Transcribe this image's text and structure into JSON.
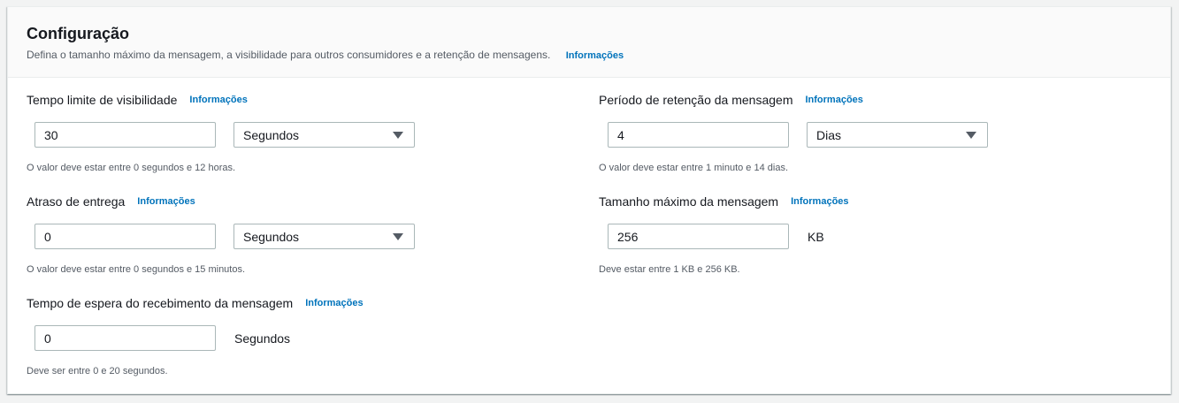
{
  "section": {
    "title": "Configuração",
    "description": "Defina o tamanho máximo da mensagem, a visibilidade para outros consumidores e a retenção de mensagens.",
    "info_link": "Informações"
  },
  "fields": {
    "visibility_timeout": {
      "label": "Tempo limite de visibilidade",
      "info_link": "Informações",
      "value": "30",
      "unit": "Segundos",
      "hint": "O valor deve estar entre 0 segundos e 12 horas."
    },
    "delivery_delay": {
      "label": "Atraso de entrega",
      "info_link": "Informações",
      "value": "0",
      "unit": "Segundos",
      "hint": "O valor deve estar entre 0 segundos e 15 minutos."
    },
    "receive_wait_time": {
      "label": "Tempo de espera do recebimento da mensagem",
      "info_link": "Informações",
      "value": "0",
      "unit": "Segundos",
      "hint": "Deve ser entre 0 e 20 segundos."
    },
    "retention_period": {
      "label": "Período de retenção da mensagem",
      "info_link": "Informações",
      "value": "4",
      "unit": "Dias",
      "hint": "O valor deve estar entre 1 minuto e 14 dias."
    },
    "max_message_size": {
      "label": "Tamanho máximo da mensagem",
      "info_link": "Informações",
      "value": "256",
      "unit": "KB",
      "hint": "Deve estar entre 1 KB e 256 KB."
    }
  },
  "colors": {
    "link": "#0073bb",
    "text": "#16191f",
    "secondary_text": "#545b64",
    "input_border": "#aab7b8",
    "header_background": "#fafafa",
    "page_background": "#f2f3f3"
  },
  "icons": {
    "select_caret": "caret-down-icon"
  }
}
